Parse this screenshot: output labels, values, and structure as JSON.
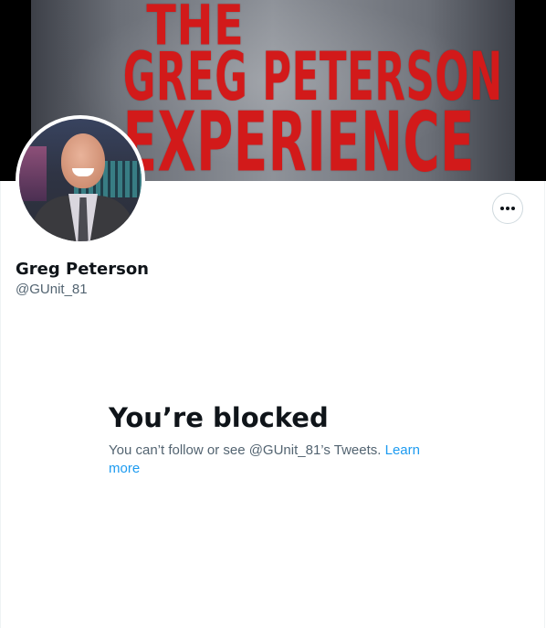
{
  "banner": {
    "line1": "THE",
    "line2": "GREG PETERSON",
    "line3": "EXPERIENCE"
  },
  "profile": {
    "display_name": "Greg Peterson",
    "handle": "@GUnit_81"
  },
  "actions": {
    "more_icon": "more-horizontal-icon"
  },
  "blocked": {
    "title": "You’re blocked",
    "description": "You can’t follow or see @GUnit_81’s Tweets.",
    "link_text": "Learn more"
  },
  "colors": {
    "link": "#1d9bf0",
    "secondary_text": "#536471",
    "primary_text": "#0f1419",
    "banner_text": "#d21a1a"
  }
}
